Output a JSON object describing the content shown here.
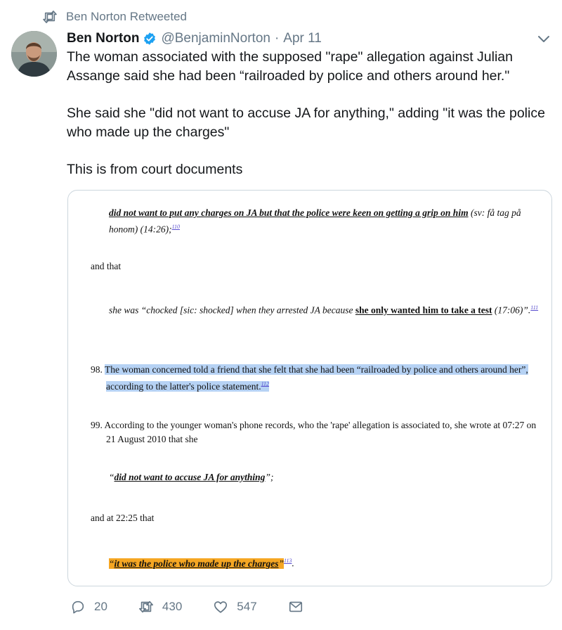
{
  "retweet": {
    "text": "Ben Norton Retweeted",
    "icon": "retweet-icon"
  },
  "author": {
    "name": "Ben Norton",
    "handle": "@BenjaminNorton",
    "separator": "·",
    "date": "Apr 11",
    "verified_icon": "verified-badge-icon"
  },
  "tweet": {
    "paragraphs": [
      "The woman associated with the supposed \"rape\" allegation against Julian Assange said she had been “railroaded by police and others around her.\"",
      "She said she \"did not want to accuse JA for anything,\" adding \"it was the police who made up the charges\"",
      "This is from court documents"
    ]
  },
  "document": {
    "l1_u": "did not want to put any charges on JA but that the police were keen on getting a grip on him",
    "l1_tail": " (sv: få tag på",
    "l2": "honom) (14:26);",
    "fn110": "110",
    "and_that": "and that",
    "l3_pre": "she was “chocked [sic: shocked] when they arrested JA because ",
    "l3_u": "she only wanted him to take a test",
    "l3_post": " (17:06)”.",
    "fn111": "111",
    "p98_num": "98.",
    "p98_l1": "The woman concerned told a friend that she felt that she had been “railroaded by police and others around her”,",
    "p98_l2": "according to the latter's police statement.",
    "fn112": "112",
    "p99_num": "99.",
    "p99_l1": "According to the younger woman's phone records, who the 'rape' allegation is associated to, she wrote at 07:27 on",
    "p99_l2": "21 August 2010 that she",
    "q1_open": "“",
    "q1_u": "did not want to accuse JA for anything",
    "q1_close": "”;",
    "and_at": "and at 22:25 that",
    "q2_open": "“",
    "q2_u": "it was the police who made up the charges",
    "q2_close": "”",
    "fn113": "113",
    "q2_end": "."
  },
  "actions": {
    "reply_count": "20",
    "retweet_count": "430",
    "like_count": "547"
  },
  "colors": {
    "highlight_blue": "#b6d2f4",
    "highlight_orange": "#f5a623",
    "verified_blue": "#1da1f2",
    "muted": "#657786"
  }
}
